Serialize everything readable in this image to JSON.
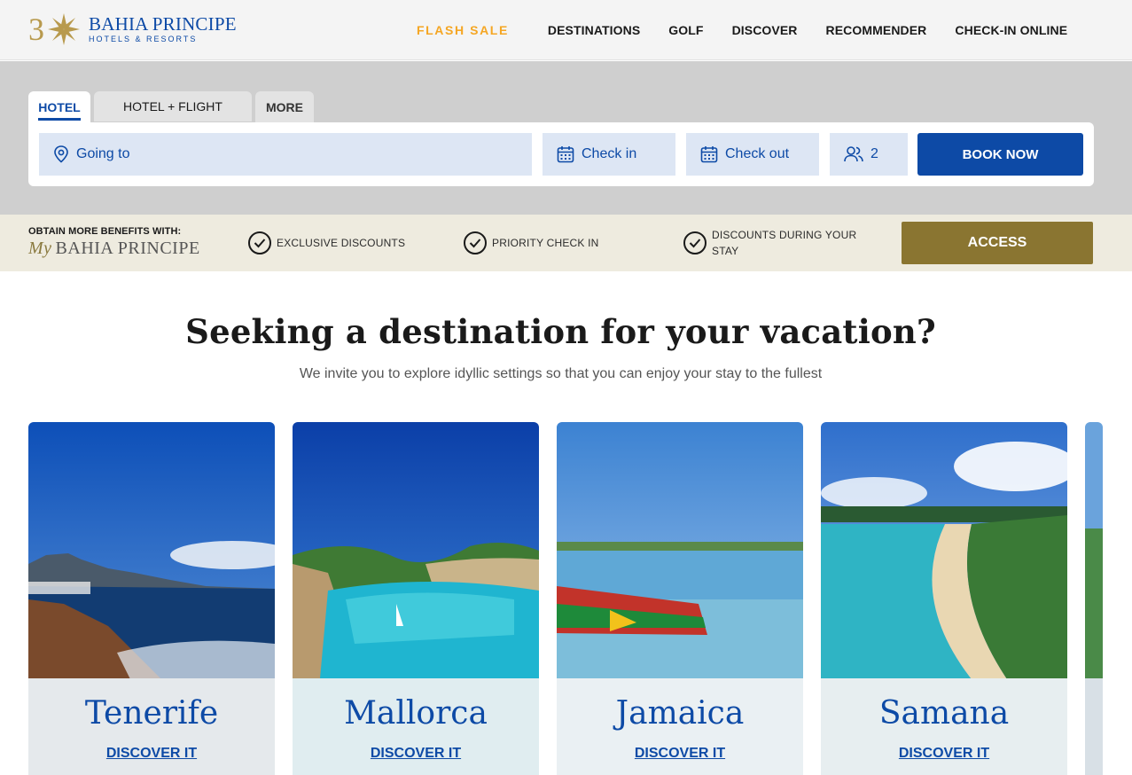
{
  "brand": {
    "name": "BAHIA PRINCIPE",
    "sub": "HOTELS & RESORTS",
    "numeral": "3"
  },
  "nav": {
    "flash_sale": "FLASH SALE",
    "items": [
      "DESTINATIONS",
      "GOLF",
      "DISCOVER",
      "RECOMMENDER",
      "CHECK-IN ONLINE"
    ]
  },
  "search": {
    "tabs": [
      "HOTEL",
      "HOTEL + FLIGHT",
      "MORE"
    ],
    "active_tab": "HOTEL",
    "going_to": "Going to",
    "check_in": "Check in",
    "check_out": "Check out",
    "guests": "2",
    "book_button": "BOOK NOW"
  },
  "benefits": {
    "obtain": "OBTAIN MORE BENEFITS WITH:",
    "brand_my": "My",
    "brand_name": "BAHIA PRINCIPE",
    "items": [
      "EXCLUSIVE DISCOUNTS",
      "PRIORITY CHECK IN",
      "DISCOUNTS DURING YOUR STAY"
    ],
    "access_button": "ACCESS"
  },
  "hero": {
    "heading": "Seeking a destination for your vacation?",
    "subheading": "We invite you to explore idyllic settings so that you can enjoy your stay to the fullest"
  },
  "destinations": [
    {
      "name": "Tenerife",
      "link": "DISCOVER IT"
    },
    {
      "name": "Mallorca",
      "link": "DISCOVER IT"
    },
    {
      "name": "Jamaica",
      "link": "DISCOVER IT"
    },
    {
      "name": "Samana",
      "link": "DISCOVER IT"
    }
  ],
  "colors": {
    "primary": "#0d4aa6",
    "flash": "#f5a623",
    "access": "#8a7531",
    "benefits_bg": "#eeebdf"
  }
}
